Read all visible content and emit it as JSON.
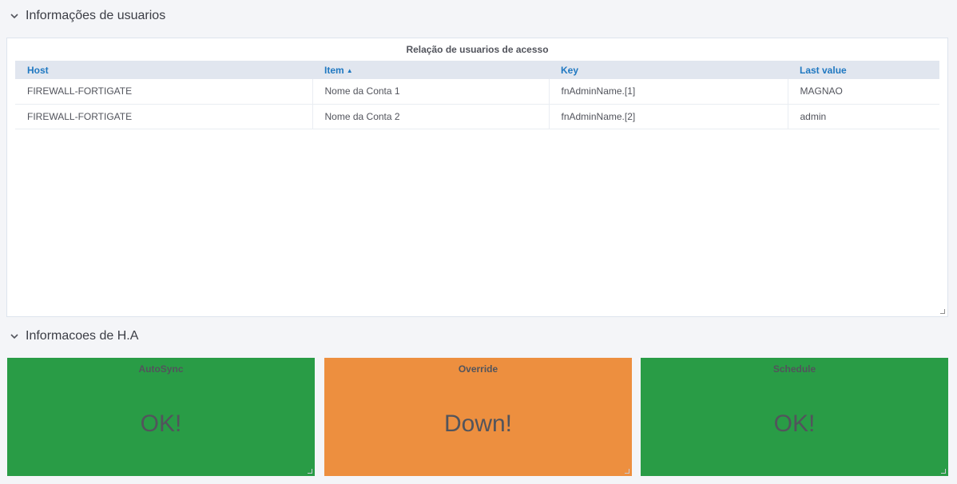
{
  "rows": {
    "users": {
      "title": "Informações de usuarios"
    },
    "ha": {
      "title": "Informacoes de H.A"
    }
  },
  "users_panel": {
    "title": "Relação de usuarios de acesso",
    "columns": [
      "Host",
      "Item",
      "Key",
      "Last value"
    ],
    "sorted_column": "Item",
    "sort_direction": "ascending",
    "rows": [
      [
        "FIREWALL-FORTIGATE",
        "Nome da Conta 1",
        "fnAdminName.[1]",
        "MAGNAO"
      ],
      [
        "FIREWALL-FORTIGATE",
        "Nome da Conta 2",
        "fnAdminName.[2]",
        "admin"
      ]
    ]
  },
  "ha_panels": [
    {
      "title": "AutoSync",
      "value": "OK!",
      "color": "#299c46"
    },
    {
      "title": "Override",
      "value": "Down!",
      "color": "#ed8f3f"
    },
    {
      "title": "Schedule",
      "value": "OK!",
      "color": "#299c46"
    }
  ],
  "colors": {
    "header_link": "#1f78c1",
    "ok": "#299c46",
    "warn": "#ed8f3f"
  }
}
